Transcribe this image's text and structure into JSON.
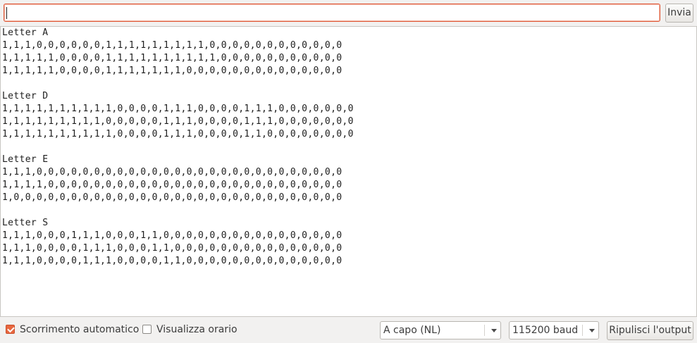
{
  "input": {
    "value": "",
    "placeholder": ""
  },
  "send_button": {
    "label": "Invia"
  },
  "output_lines": [
    "Letter A",
    "1,1,1,0,0,0,0,0,0,1,1,1,1,1,1,1,1,1,0,0,0,0,0,0,0,0,0,0,0,0",
    "1,1,1,1,1,0,0,0,0,1,1,1,1,1,1,1,1,1,1,0,0,0,0,0,0,0,0,0,0,0",
    "1,1,1,1,1,0,0,0,0,1,1,1,1,1,1,1,0,0,0,0,0,0,0,0,0,0,0,0,0,0",
    "",
    "Letter D",
    "1,1,1,1,1,1,1,1,1,1,0,0,0,0,1,1,1,0,0,0,0,1,1,1,0,0,0,0,0,0,0",
    "1,1,1,1,1,1,1,1,1,0,0,0,0,0,1,1,1,0,0,0,0,1,1,1,0,0,0,0,0,0,0",
    "1,1,1,1,1,1,1,1,1,1,0,0,0,0,1,1,1,0,0,0,0,1,1,0,0,0,0,0,0,0,0",
    "",
    "Letter E",
    "1,1,1,0,0,0,0,0,0,0,0,0,0,0,0,0,0,0,0,0,0,0,0,0,0,0,0,0,0,0",
    "1,1,1,1,0,0,0,0,0,0,0,0,0,0,0,0,0,0,0,0,0,0,0,0,0,0,0,0,0,0",
    "1,0,0,0,0,0,0,0,0,0,0,0,0,0,0,0,0,0,0,0,0,0,0,0,0,0,0,0,0,0",
    "",
    "Letter S",
    "1,1,1,0,0,0,1,1,1,0,0,0,1,1,0,0,0,0,0,0,0,0,0,0,0,0,0,0,0,0",
    "1,1,1,0,0,0,0,1,1,1,0,0,0,1,1,0,0,0,0,0,0,0,0,0,0,0,0,0,0,0",
    "1,1,1,0,0,0,0,1,1,1,0,0,0,0,1,1,0,0,0,0,0,0,0,0,0,0,0,0,0,0"
  ],
  "autoscroll": {
    "label": "Scorrimento automatico",
    "checked": true
  },
  "timestamp": {
    "label": "Visualizza orario",
    "checked": false
  },
  "line_ending": {
    "selected": "A capo (NL)"
  },
  "baud_rate": {
    "selected": "115200 baud"
  },
  "clear_button": {
    "label": "Ripulisci l'output"
  },
  "colors": {
    "accent": "#e8673f",
    "focus_border": "#e05a3a",
    "window_bg": "#f2f1f0",
    "output_bg": "#ffffff"
  },
  "icons": {
    "checkbox_checked": "checkmark-icon",
    "dropdown": "chevron-down-icon"
  }
}
